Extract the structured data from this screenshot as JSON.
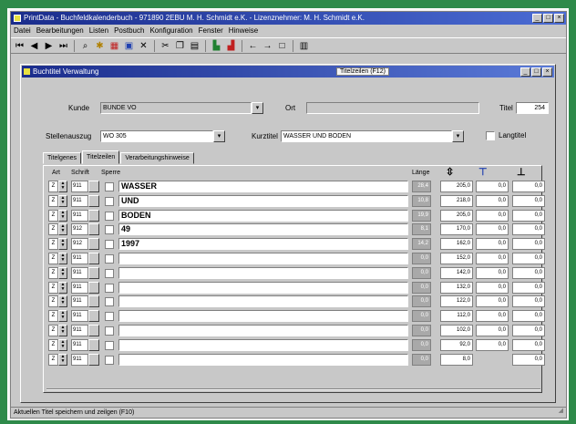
{
  "window": {
    "title": "PrintData - Buchfeldkalenderbuch - 971890 2EBU M. H. Schmidt e.K. - Lizenznehmer: M. H. Schmidt e.K."
  },
  "menu": [
    "Datei",
    "Bearbeitungen",
    "Listen",
    "Postbuch",
    "Konfiguration",
    "Fenster",
    "Hinweise"
  ],
  "toolbar": {
    "icons": [
      "first-icon",
      "prev-icon",
      "next-icon",
      "last-icon",
      "search-icon",
      "star-icon",
      "delete-icon",
      "save-icon",
      "cancel-icon",
      "cut-icon",
      "copy-icon",
      "paste-icon",
      "chart-icon",
      "chart2-icon",
      "back-icon",
      "forward-icon",
      "new-icon",
      "grid-icon"
    ]
  },
  "child_window": {
    "title": "Buchtitel Verwaltung",
    "badge": "Titelzeilen (F12)"
  },
  "form": {
    "kunde_label": "Kunde",
    "kunde_value": "BUNDE VO",
    "ort_label": "Ort",
    "ort_value": "",
    "titel_label": "Titel",
    "titel_value": "254",
    "stellenauszug_label": "Stellenauszug",
    "stellenauszug_value": "WO 305",
    "kurztitel_label": "Kurztitel",
    "kurztitel_value": "WASSER UND BODEN",
    "langtitel_label": "Langtitel"
  },
  "tabs": [
    "Titelgenes",
    "Titelzeilen",
    "Verarbeitungshinweise"
  ],
  "active_tab": 1,
  "columns": {
    "art": "Art",
    "schrift": "Schrift",
    "sperre": "Sperre",
    "laenge": "Länge"
  },
  "rows": [
    {
      "art": "Z",
      "schrift": "911",
      "text": "WASSER",
      "laenge": "28,4",
      "v1": "205,0",
      "v2": "0,0",
      "v3": "0,0"
    },
    {
      "art": "Z",
      "schrift": "911",
      "text": "UND",
      "laenge": "10,8",
      "v1": "218,0",
      "v2": "0,0",
      "v3": "0,0"
    },
    {
      "art": "Z",
      "schrift": "911",
      "text": "BODEN",
      "laenge": "19,9",
      "v1": "205,0",
      "v2": "0,0",
      "v3": "0,0"
    },
    {
      "art": "Z",
      "schrift": "912",
      "text": "49",
      "laenge": "8,1",
      "v1": "170,0",
      "v2": "0,0",
      "v3": "0,0"
    },
    {
      "art": "Z",
      "schrift": "912",
      "text": "1997",
      "laenge": "14,2",
      "v1": "162,0",
      "v2": "0,0",
      "v3": "0,0"
    },
    {
      "art": "Z",
      "schrift": "911",
      "text": "",
      "laenge": "0,0",
      "v1": "152,0",
      "v2": "0,0",
      "v3": "0,0"
    },
    {
      "art": "Z",
      "schrift": "911",
      "text": "",
      "laenge": "0,0",
      "v1": "142,0",
      "v2": "0,0",
      "v3": "0,0"
    },
    {
      "art": "Z",
      "schrift": "911",
      "text": "",
      "laenge": "0,0",
      "v1": "132,0",
      "v2": "0,0",
      "v3": "0,0"
    },
    {
      "art": "Z",
      "schrift": "911",
      "text": "",
      "laenge": "0,0",
      "v1": "122,0",
      "v2": "0,0",
      "v3": "0,0"
    },
    {
      "art": "Z",
      "schrift": "911",
      "text": "",
      "laenge": "0,0",
      "v1": "112,0",
      "v2": "0,0",
      "v3": "0,0"
    },
    {
      "art": "Z",
      "schrift": "911",
      "text": "",
      "laenge": "0,0",
      "v1": "102,0",
      "v2": "0,0",
      "v3": "0,0"
    },
    {
      "art": "Z",
      "schrift": "911",
      "text": "",
      "laenge": "0,0",
      "v1": "92,0",
      "v2": "0,0",
      "v3": "0,0"
    },
    {
      "art": "Z",
      "schrift": "911",
      "text": "",
      "laenge": "0,0",
      "v1": "8,0",
      "v2": "",
      "v3": "0,0"
    }
  ],
  "status": "Aktuellen Titel speichern und zeilgen (F10)"
}
